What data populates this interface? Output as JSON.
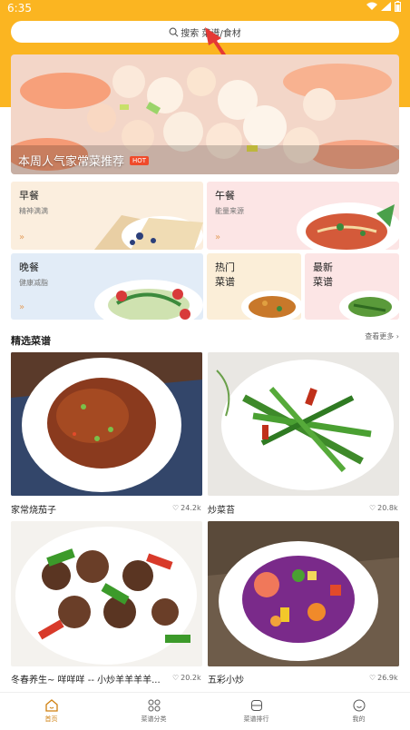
{
  "status": {
    "time": "6:35"
  },
  "search": {
    "placeholder": "搜索 菜谱/食材"
  },
  "banner": {
    "title": "本周人气家常菜推荐",
    "badge": "HOT"
  },
  "categories": [
    {
      "title": "早餐",
      "subtitle": "精神满满"
    },
    {
      "title": "午餐",
      "subtitle": "能量来源"
    },
    {
      "title": "晚餐",
      "subtitle": "健康减脂"
    },
    {
      "title": "热门\n菜谱",
      "subtitle": ""
    },
    {
      "title": "最新\n菜谱",
      "subtitle": ""
    }
  ],
  "section": {
    "title": "精选菜谱",
    "more": "查看更多"
  },
  "recipes": [
    {
      "name": "家常烧茄子",
      "likes": "24.2k"
    },
    {
      "name": "炒菜苔",
      "likes": "20.8k"
    },
    {
      "name": "冬春养生~ 咩咩咩 -- 小炒羊羊羊羊...",
      "likes": "20.2k"
    },
    {
      "name": "五彩小炒",
      "likes": "26.9k"
    }
  ],
  "nav": [
    {
      "label": "首页",
      "active": true
    },
    {
      "label": "菜谱分类",
      "active": false
    },
    {
      "label": "菜谱排行",
      "active": false
    },
    {
      "label": "我的",
      "active": false
    }
  ],
  "colors": {
    "accent": "#fbb521",
    "hot": "#f04a2a",
    "active_tab": "#d08010"
  }
}
